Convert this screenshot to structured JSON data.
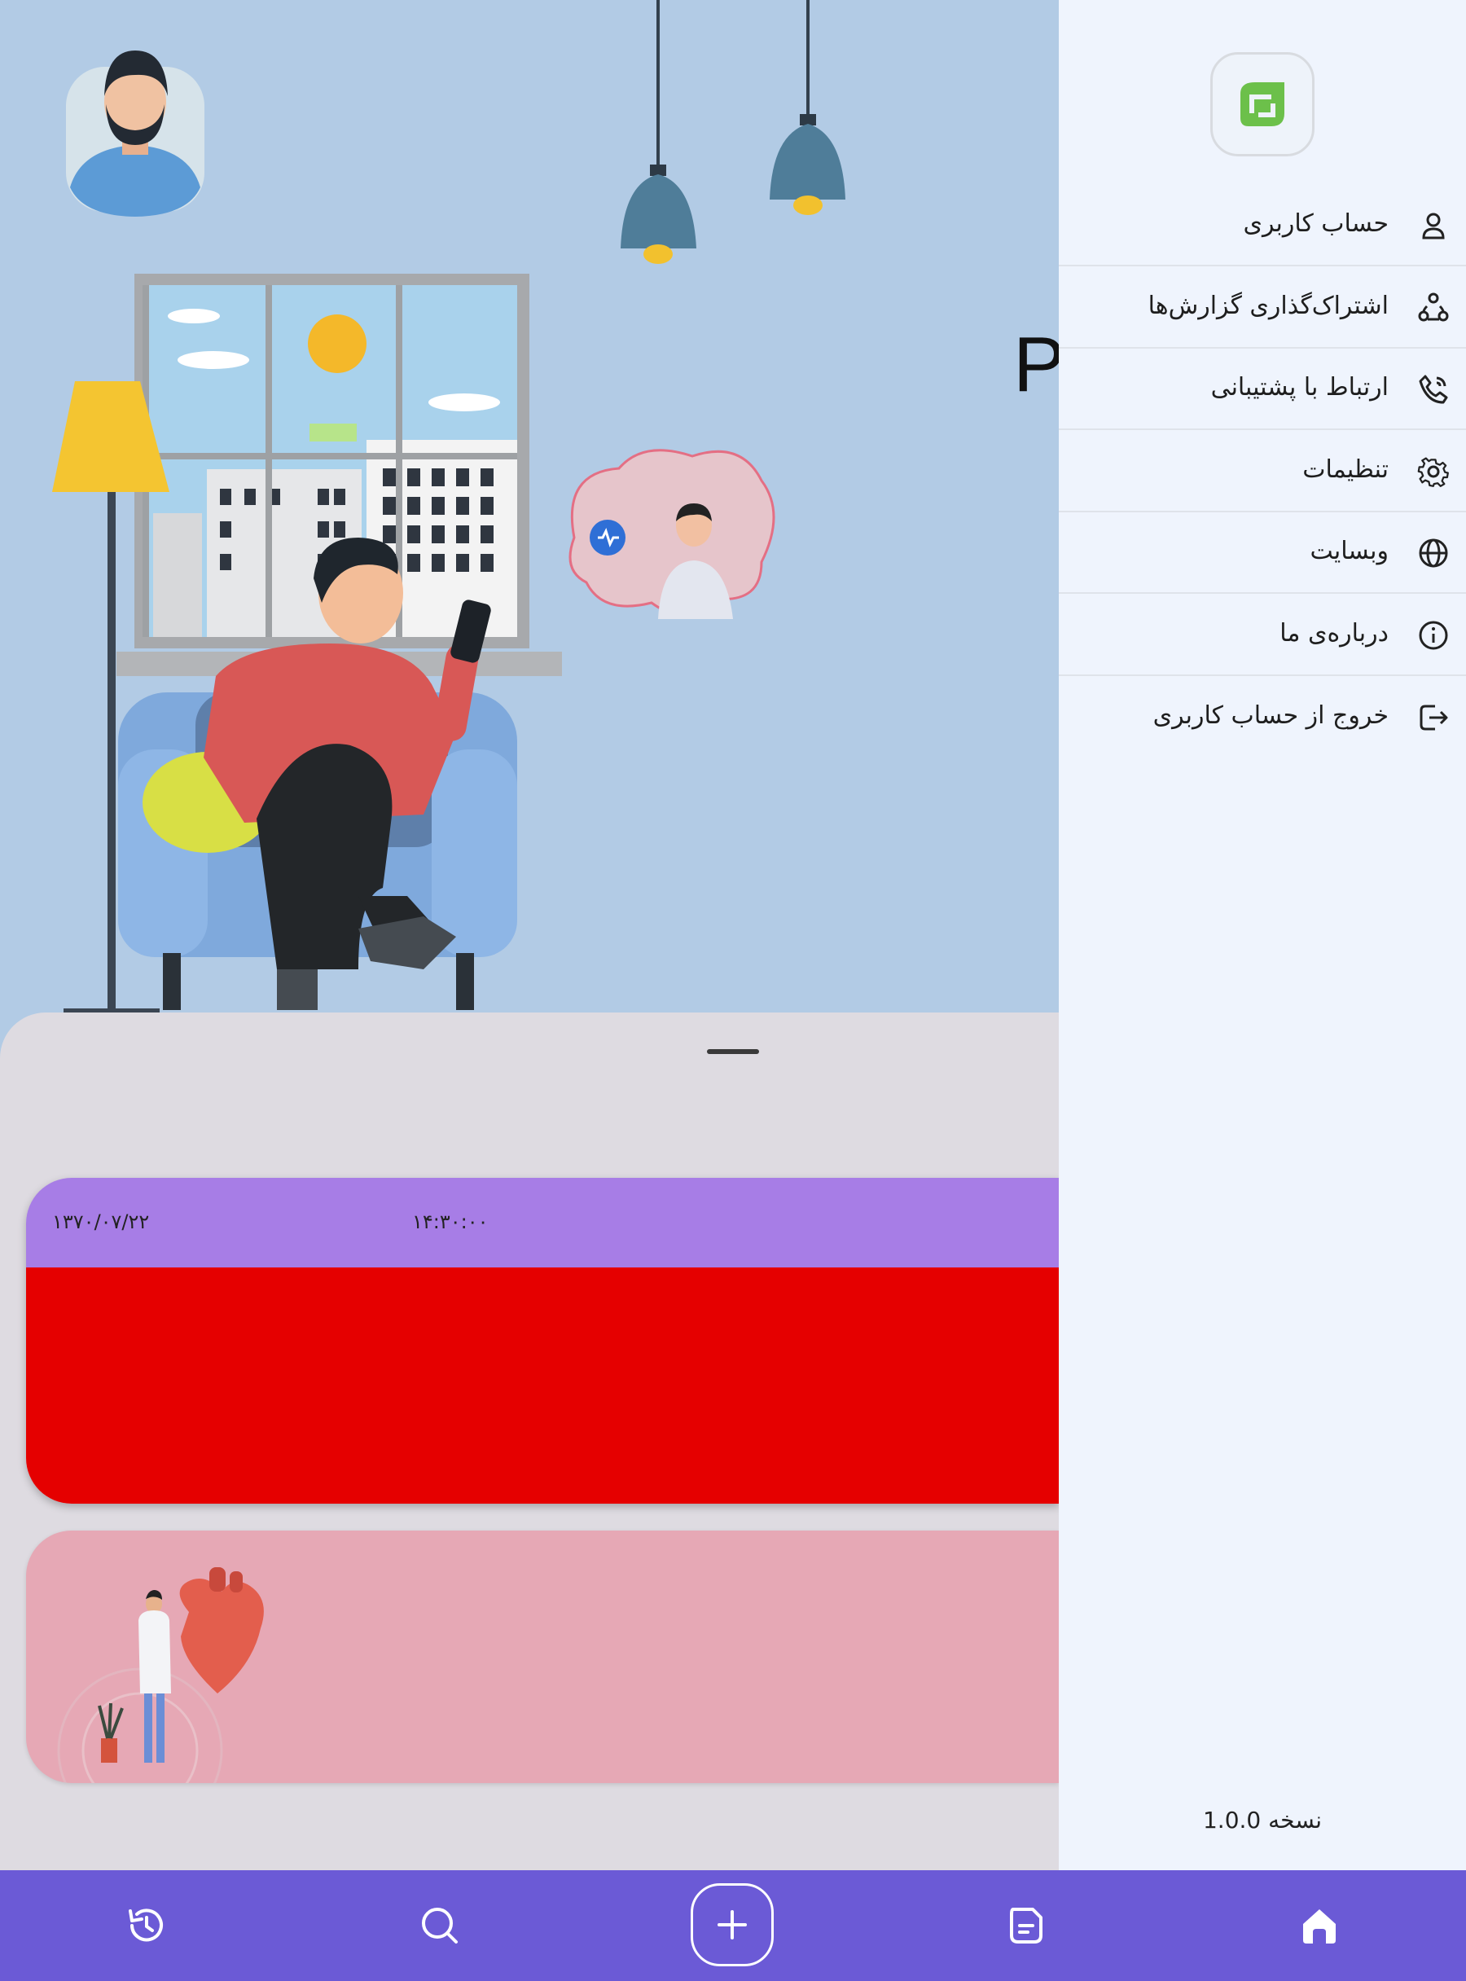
{
  "hero": {
    "overlay_letter": "P"
  },
  "reading_card": {
    "date": "۱۳۷۰/۰۷/۲۲",
    "time": "۱۴:۳۰:۰۰",
    "header_color": "#a77de6",
    "body_color": "#e50000"
  },
  "heart_card": {
    "background": "#e6a8b5"
  },
  "drawer": {
    "logo_icon": "leaf-logo-icon",
    "items": [
      {
        "label": "حساب کاربری",
        "icon": "user-icon"
      },
      {
        "label": "اشتراک‌گذاری گزارش‌ها",
        "icon": "share-nodes-icon"
      },
      {
        "label": "ارتباط با پشتیبانی",
        "icon": "phone-icon"
      },
      {
        "label": "تنظیمات",
        "icon": "gear-icon"
      },
      {
        "label": "وبسایت",
        "icon": "globe-icon"
      },
      {
        "label": "درباره‌ی ما",
        "icon": "info-icon"
      },
      {
        "label": "خروج از حساب کاربری",
        "icon": "logout-icon"
      }
    ],
    "version": "نسخه 1.0.0"
  },
  "bottom_nav": {
    "items": [
      "history-icon",
      "search-icon",
      "add-icon",
      "report-icon",
      "home-icon"
    ],
    "active": "home-icon",
    "color": "#6b5ad6"
  }
}
